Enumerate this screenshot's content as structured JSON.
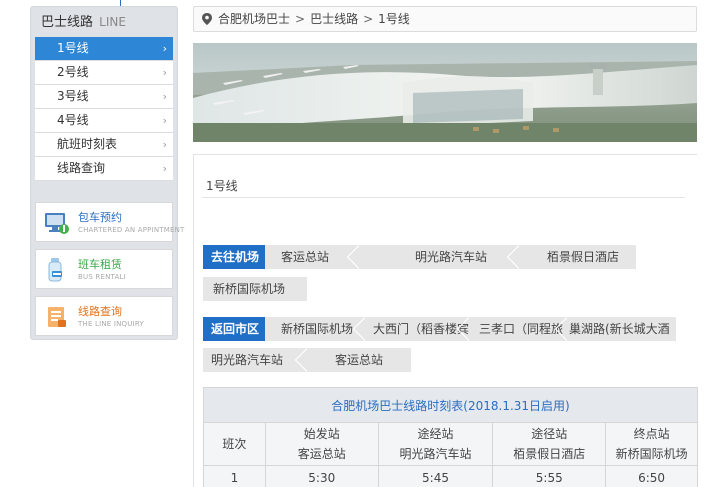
{
  "sidebar": {
    "title": "巴士线路",
    "title_en": "LINE",
    "items": [
      {
        "label": "1号线",
        "active": true
      },
      {
        "label": "2号线"
      },
      {
        "label": "3号线"
      },
      {
        "label": "4号线"
      },
      {
        "label": "航班时刻表"
      },
      {
        "label": "线路查询"
      }
    ],
    "chevron": "›",
    "services": [
      {
        "title": "包车预约",
        "subtitle": "CHARTERED AN APPINTMENT",
        "color": "#2a6fc2",
        "icon": "monitor-hand-icon"
      },
      {
        "title": "班车租赁",
        "subtitle": "BUS RENTALI",
        "color": "#3aa84a",
        "icon": "bus-bottle-icon"
      },
      {
        "title": "线路查询",
        "subtitle": "THE LINE INQUIRY",
        "color": "#e2731e",
        "icon": "document-icon"
      }
    ]
  },
  "breadcrumb": {
    "items": [
      "合肥机场巴士",
      "巴士线路",
      "1号线"
    ],
    "separator": ">"
  },
  "content": {
    "line_name": "1号线",
    "to_airport": {
      "label": "去往机场",
      "stops_row1": [
        "客运总站",
        "明光路汽车站",
        "栢景假日酒店"
      ],
      "stops_row2": [
        "新桥国际机场"
      ]
    },
    "to_city": {
      "label": "返回市区",
      "stops_row1": [
        "新桥国际机场",
        "大西门（稻香楼宾",
        "三孝口（同程旅",
        "巢湖路(新长城大酒"
      ],
      "stops_row2": [
        "明光路汽车站",
        "客运总站"
      ]
    },
    "timetable": {
      "caption": "合肥机场巴士线路时刻表(2018.1.31日启用)",
      "headers": [
        {
          "top": "班次",
          "bottom": ""
        },
        {
          "top": "始发站",
          "bottom": "客运总站"
        },
        {
          "top": "途经站",
          "bottom": "明光路汽车站"
        },
        {
          "top": "途径站",
          "bottom": "栢景假日酒店"
        },
        {
          "top": "终点站",
          "bottom": "新桥国际机场"
        }
      ],
      "rows": [
        [
          "1",
          "5:30",
          "5:45",
          "5:55",
          "6:50"
        ]
      ]
    }
  },
  "colors": {
    "accent": "#2e86d6",
    "route_blue": "#1f6fc6"
  }
}
